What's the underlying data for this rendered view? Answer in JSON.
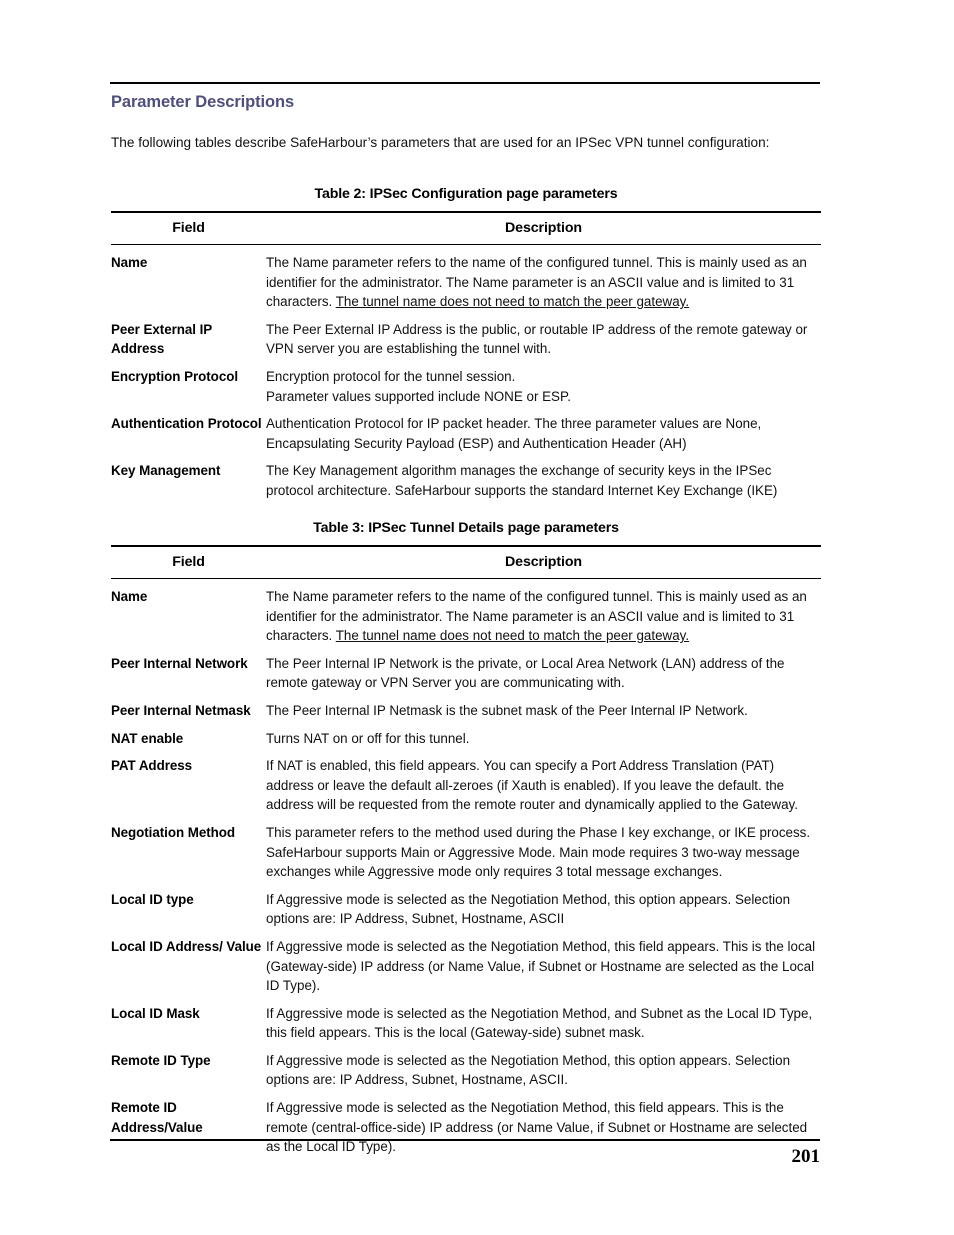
{
  "document": {
    "section_heading": "Parameter Descriptions",
    "intro": "The following tables describe SafeHarbour’s parameters that are used for an IPSec VPN tunnel configuration:",
    "page_number": "201",
    "heading_color": "#4f4f7d"
  },
  "tables": [
    {
      "caption": "Table 2: IPSec Configuration page parameters",
      "headers": {
        "field": "Field",
        "description": "Description"
      },
      "rows": [
        {
          "field": "Name",
          "desc_plain": "The Name parameter refers to the name of the configured tunnel. This is mainly used as an identifier for the administrator. The Name parameter is an ASCII value and is limited to 31 characters. ",
          "desc_underlined": "The tunnel name does not need to match the peer gateway."
        },
        {
          "field": "Peer External IP Address",
          "desc_plain": "The Peer External IP Address is the public, or routable IP address of the remote gateway or VPN server you are establishing the tunnel with."
        },
        {
          "field": "Encryption Protocol",
          "desc_plain": "Encryption protocol for the tunnel session.",
          "desc_second": "Parameter values supported include NONE or ESP."
        },
        {
          "field": "Authentication Protocol",
          "desc_plain": "Authentication Protocol for IP packet header. The three parameter values are None, Encapsulating Security Payload (ESP) and Authentication Header (AH)"
        },
        {
          "field": "Key Management",
          "desc_plain": "The Key Management algorithm manages the exchange of security keys in the IPSec protocol architecture. SafeHarbour supports the standard Internet Key Exchange (IKE)"
        }
      ]
    },
    {
      "caption": "Table 3: IPSec Tunnel Details page parameters",
      "headers": {
        "field": "Field",
        "description": "Description"
      },
      "rows": [
        {
          "field": "Name",
          "desc_plain": "The Name parameter refers to the name of the configured tunnel. This is mainly used as an identifier for the administrator. The Name parameter is an ASCII value and is limited to 31 characters. ",
          "desc_underlined": "The tunnel name does not need to match the peer gateway."
        },
        {
          "field": "Peer Internal Network",
          "desc_plain": "The Peer Internal IP Network is the private, or Local Area Network (LAN) address of the remote gateway or VPN Server you are communicating with."
        },
        {
          "field": "Peer Internal Netmask",
          "desc_plain": "The Peer Internal IP Netmask is the subnet mask of the Peer Internal IP Network."
        },
        {
          "field": "NAT enable",
          "desc_plain": "Turns NAT on or off for this tunnel."
        },
        {
          "field": "PAT Address",
          "desc_plain": "If NAT is enabled, this field appears. You can specify a Port Address Translation (PAT) address or leave the default all-zeroes (if Xauth is enabled). If you leave the default. the address will be requested from the remote router and dynamically applied to the Gateway."
        },
        {
          "field": "Negotiation Method",
          "desc_plain": "This parameter refers to the method used during the Phase I key exchange, or IKE process. SafeHarbour supports Main or Aggressive Mode. Main mode requires 3 two-way message exchanges while Aggressive mode only requires 3 total message exchanges."
        },
        {
          "field": "Local ID type",
          "desc_plain": "If Aggressive mode is selected as the Negotiation Method, this option appears. Selection options are: IP Address, Subnet, Hostname, ASCII"
        },
        {
          "field": "Local ID Address/ Value",
          "desc_plain": "If Aggressive mode is selected as the Negotiation Method, this field appears. This is the local (Gateway-side) IP address (or Name Value, if Subnet or Hostname are selected as the Local ID Type)."
        },
        {
          "field": "Local ID Mask",
          "desc_plain": "If Aggressive mode is selected as the Negotiation Method, and Subnet as the Local ID Type, this field appears. This is the local (Gateway-side) subnet mask."
        },
        {
          "field": "Remote ID Type",
          "desc_plain": "If Aggressive mode is selected as the Negotiation Method, this option appears. Selection options are: IP Address, Subnet, Hostname, ASCII."
        },
        {
          "field": "Remote ID Address/Value",
          "desc_plain": "If Aggressive mode is selected as the Negotiation Method, this field appears. This is the remote (central-office-side) IP address (or Name Value, if Subnet or Hostname are selected as the Local ID Type)."
        }
      ]
    }
  ]
}
